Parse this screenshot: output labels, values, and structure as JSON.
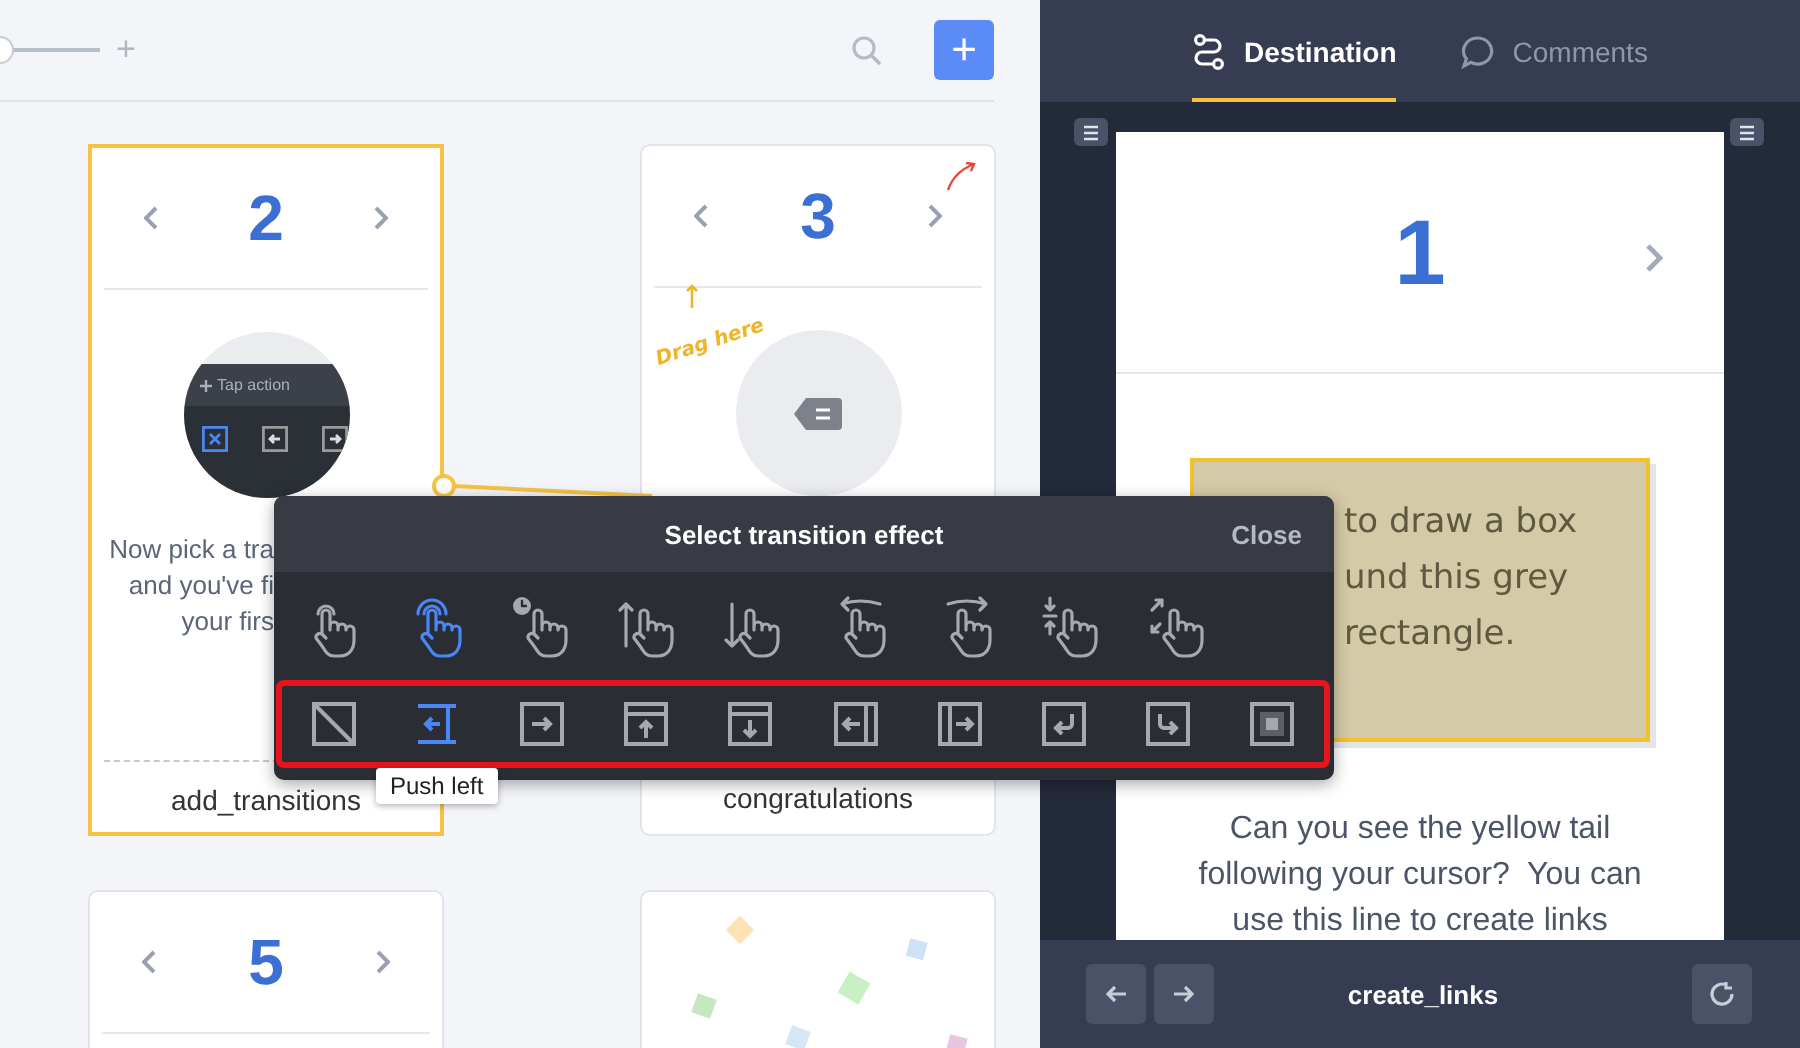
{
  "toolbar": {
    "zoom": {
      "level": 0
    },
    "zoom_in": "+",
    "add_button": "+"
  },
  "cards": [
    {
      "kind": "tap_preview",
      "number": "2",
      "selected": true,
      "preview_label": "Tap action",
      "lines": [
        "Now pick a tra",
        "and you've fi",
        "your firs"
      ],
      "label": "add_transitions"
    },
    {
      "kind": "tag_preview",
      "number": "3",
      "selected": false,
      "hint": "Drag here",
      "label": "congratulations"
    },
    {
      "kind": "plain",
      "number": "5",
      "selected": false
    },
    {
      "kind": "confetti",
      "selected": false
    }
  ],
  "popup": {
    "title": "Select transition effect",
    "close": "Close",
    "gestures": [
      {
        "kind": "tap",
        "selected": false
      },
      {
        "kind": "double_tap",
        "selected": true
      },
      {
        "kind": "long_press",
        "selected": false
      },
      {
        "kind": "swipe_up",
        "selected": false
      },
      {
        "kind": "swipe_down",
        "selected": false
      },
      {
        "kind": "swipe_left",
        "selected": false
      },
      {
        "kind": "swipe_right",
        "selected": false
      },
      {
        "kind": "pinch",
        "selected": false
      },
      {
        "kind": "spread",
        "selected": false
      }
    ],
    "transition_row": {
      "highlighted": true,
      "items": [
        {
          "kind": "none",
          "selected": false
        },
        {
          "kind": "push_left",
          "selected": true
        },
        {
          "kind": "slide_right",
          "selected": false
        },
        {
          "kind": "slide_up",
          "selected": false
        },
        {
          "kind": "slide_down",
          "selected": false
        },
        {
          "kind": "reveal_left",
          "selected": false
        },
        {
          "kind": "reveal_right",
          "selected": false
        },
        {
          "kind": "flip_left",
          "selected": false
        },
        {
          "kind": "flip_right",
          "selected": false
        },
        {
          "kind": "fade",
          "selected": false
        }
      ]
    },
    "tooltip": "Push left"
  },
  "tabs": [
    {
      "kind": "route",
      "label": "Destination",
      "selected": true
    },
    {
      "kind": "comment",
      "label": "Comments",
      "selected": false
    }
  ],
  "preview": {
    "number": "1",
    "note_lines": [
      "to draw a box",
      "und this grey",
      "rectangle."
    ],
    "body": "Can you see the yellow tail following your cursor?  You can use this line to create links"
  },
  "footer": {
    "title": "create_links"
  }
}
